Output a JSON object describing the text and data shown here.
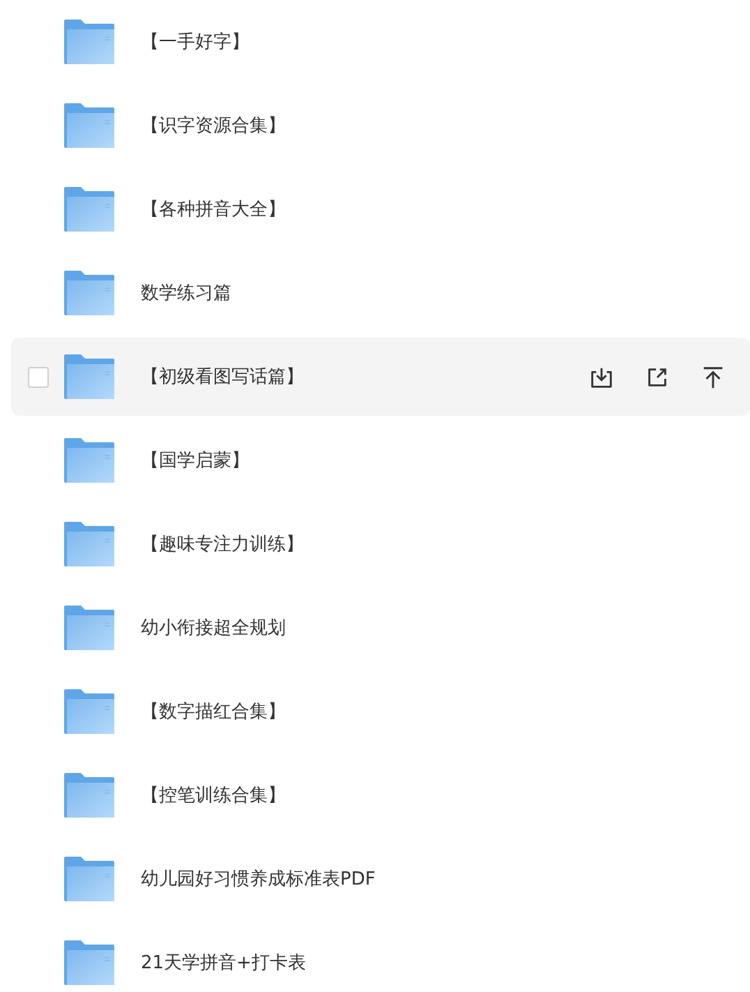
{
  "files": [
    {
      "name": "【一手好字】",
      "hovered": false,
      "checked": false
    },
    {
      "name": "【识字资源合集】",
      "hovered": false,
      "checked": false
    },
    {
      "name": "【各种拼音大全】",
      "hovered": false,
      "checked": false
    },
    {
      "name": "数学练习篇",
      "hovered": false,
      "checked": false
    },
    {
      "name": "【初级看图写话篇】",
      "hovered": true,
      "checked": false
    },
    {
      "name": "【国学启蒙】",
      "hovered": false,
      "checked": false
    },
    {
      "name": "【趣味专注力训练】",
      "hovered": false,
      "checked": false
    },
    {
      "name": "幼小衔接超全规划",
      "hovered": false,
      "checked": false
    },
    {
      "name": "【数字描红合集】",
      "hovered": false,
      "checked": false
    },
    {
      "name": "【控笔训练合集】",
      "hovered": false,
      "checked": false
    },
    {
      "name": "幼儿园好习惯养成标准表PDF",
      "hovered": false,
      "checked": false
    },
    {
      "name": "21天学拼音+打卡表",
      "hovered": false,
      "checked": false
    }
  ]
}
